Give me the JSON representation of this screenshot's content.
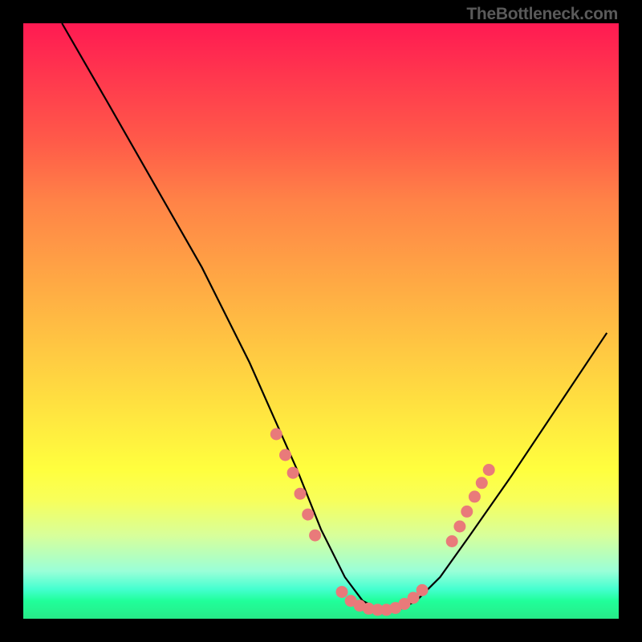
{
  "attribution": "TheBottleneck.com",
  "chart_data": {
    "type": "line",
    "title": "",
    "xlabel": "",
    "ylabel": "",
    "xlim": [
      0,
      100
    ],
    "ylim": [
      0,
      100
    ],
    "series": [
      {
        "name": "bottleneck-curve",
        "x": [
          6.5,
          14,
          22,
          30,
          38,
          42,
          46,
          50,
          54,
          57,
          60,
          63,
          66,
          70,
          75,
          82,
          90,
          98
        ],
        "y": [
          100,
          87,
          73,
          59,
          43,
          34,
          25,
          15,
          7,
          3,
          1.5,
          1.5,
          3,
          7,
          14,
          24,
          36,
          48
        ]
      }
    ],
    "markers": {
      "name": "highlight-dots",
      "color": "#e97a7a",
      "points": [
        {
          "x": 42.5,
          "y": 31
        },
        {
          "x": 44.0,
          "y": 27.5
        },
        {
          "x": 45.3,
          "y": 24.5
        },
        {
          "x": 46.5,
          "y": 21
        },
        {
          "x": 47.8,
          "y": 17.5
        },
        {
          "x": 49.0,
          "y": 14
        },
        {
          "x": 53.5,
          "y": 4.5
        },
        {
          "x": 55.0,
          "y": 3
        },
        {
          "x": 56.5,
          "y": 2.2
        },
        {
          "x": 58.0,
          "y": 1.7
        },
        {
          "x": 59.5,
          "y": 1.5
        },
        {
          "x": 61.0,
          "y": 1.5
        },
        {
          "x": 62.5,
          "y": 1.8
        },
        {
          "x": 64.0,
          "y": 2.5
        },
        {
          "x": 65.5,
          "y": 3.5
        },
        {
          "x": 67.0,
          "y": 4.8
        },
        {
          "x": 72.0,
          "y": 13
        },
        {
          "x": 73.3,
          "y": 15.5
        },
        {
          "x": 74.5,
          "y": 18
        },
        {
          "x": 75.8,
          "y": 20.5
        },
        {
          "x": 77.0,
          "y": 22.8
        },
        {
          "x": 78.2,
          "y": 25
        }
      ]
    }
  }
}
